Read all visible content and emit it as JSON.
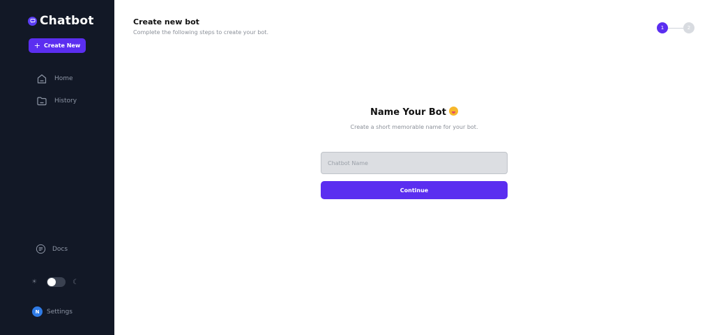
{
  "sidebar": {
    "brand": "Chatbot",
    "create_label": "Create New",
    "items": [
      {
        "label": "Home",
        "icon": "home-icon"
      },
      {
        "label": "History",
        "icon": "folder-icon"
      }
    ],
    "docs_label": "Docs",
    "settings_label": "Settings",
    "avatar_initial": "N",
    "theme": "light"
  },
  "header": {
    "title": "Create new bot",
    "subtitle": "Complete the following steps to create your bot."
  },
  "stepper": {
    "steps": [
      "1",
      "2"
    ],
    "current": 1
  },
  "form": {
    "title": "Name Your Bot",
    "subtitle": "Create a short memorable name for your bot.",
    "input_placeholder": "Chatbot Name",
    "input_value": "",
    "submit_label": "Continue"
  },
  "colors": {
    "accent": "#5b2ef0",
    "sidebar_bg": "#121826"
  }
}
